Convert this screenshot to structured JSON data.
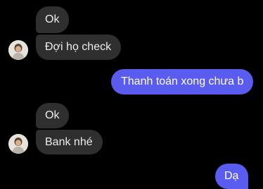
{
  "conversation": {
    "messages": [
      {
        "sender": "other",
        "text": "Ok"
      },
      {
        "sender": "other",
        "text": "Đợi họ check"
      },
      {
        "sender": "me",
        "text": "Thanh toán xong chưa b"
      },
      {
        "sender": "other",
        "text": "Ok"
      },
      {
        "sender": "other",
        "text": "Bank nhé"
      },
      {
        "sender": "me",
        "text": "Dạ"
      }
    ]
  },
  "colors": {
    "background": "#000000",
    "incoming_bubble": "#2f2f2f",
    "outgoing_bubble": "#5a5cf0"
  },
  "icons": {
    "contact_avatar": "contact-avatar-icon"
  }
}
